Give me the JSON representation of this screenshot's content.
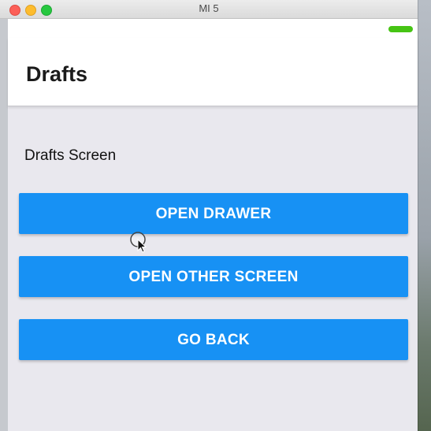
{
  "window": {
    "title": "MI 5"
  },
  "appbar": {
    "title": "Drafts"
  },
  "screen": {
    "text": "Drafts Screen"
  },
  "buttons": {
    "open_drawer": "OPEN DRAWER",
    "open_other_screen": "OPEN OTHER SCREEN",
    "go_back": "GO BACK"
  },
  "colors": {
    "accent": "#1791f4",
    "battery": "#46c414"
  },
  "icons": {
    "close": "close-icon",
    "minimize": "minimize-icon",
    "maximize": "maximize-icon",
    "cursor": "mouse-cursor-icon"
  }
}
